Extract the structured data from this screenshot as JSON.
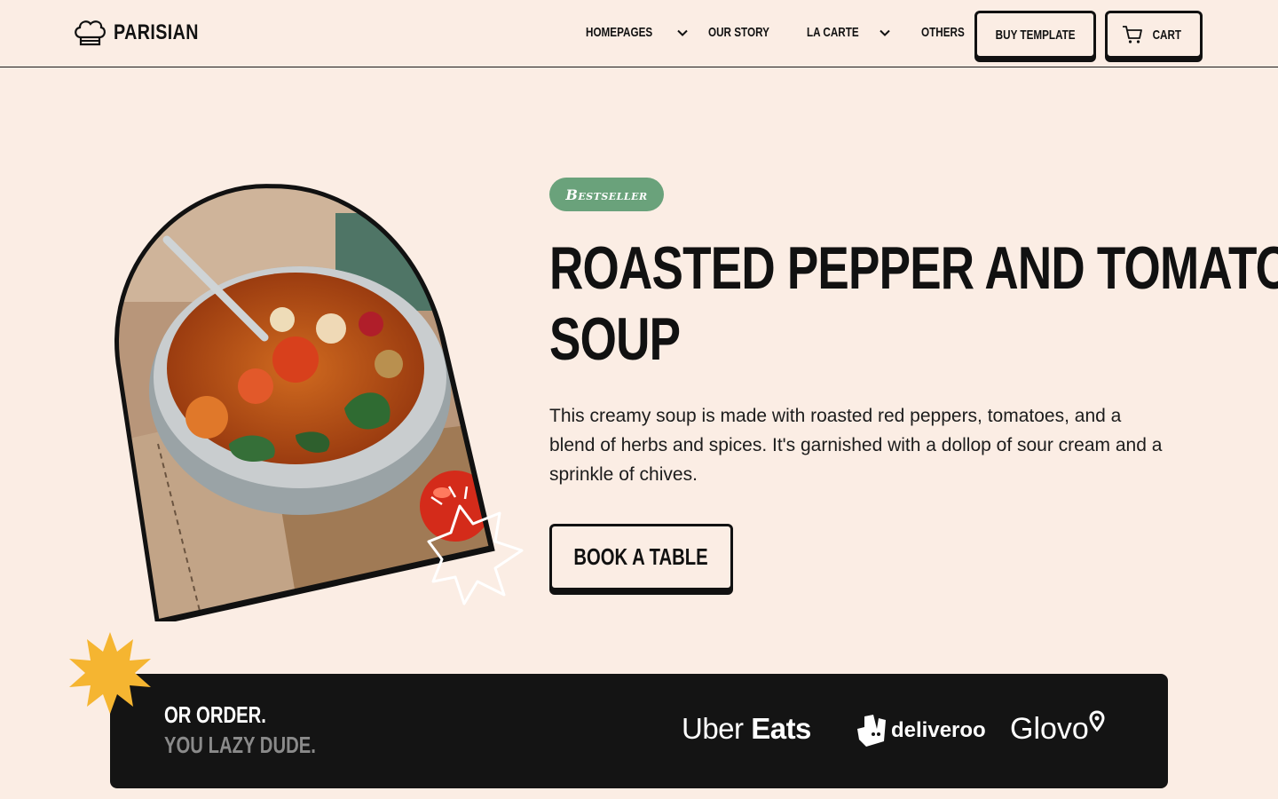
{
  "brand": {
    "name": "PARISIAN",
    "logo_icon": "chef-hat-icon"
  },
  "nav": {
    "items": [
      {
        "label": "HOMEPAGES",
        "has_dropdown": true
      },
      {
        "label": "OUR STORY",
        "has_dropdown": false
      },
      {
        "label": "LA CARTE",
        "has_dropdown": true
      },
      {
        "label": "OTHERS",
        "has_dropdown": true
      }
    ],
    "buy_label": "BUY TEMPLATE",
    "cart_label": "CART",
    "cart_icon": "cart-icon"
  },
  "hero": {
    "badge": "Bestseller",
    "title_line1": "ROASTED PEPPER AND TOMATO",
    "title_line2": "SOUP",
    "description": "This creamy soup is made with roasted red peppers, tomatoes, and a blend of herbs and spices. It's garnished with a dollop of sour cream and a sprinkle of chives.",
    "cta": "BOOK A TABLE",
    "image_icon": "soup-bowl-image"
  },
  "order": {
    "line1": "OR ORDER.",
    "line2": "YOU LAZY DUDE.",
    "partners": [
      "Uber Eats",
      "deliveroo",
      "Glovo"
    ],
    "uber_part1": "Uber",
    "uber_part2": "Eats",
    "glovo_part": "Glovo"
  },
  "colors": {
    "background": "#fbede4",
    "text": "#111111",
    "badge": "#6aa27b",
    "banner": "#141414",
    "star": "#f5b531",
    "subtext": "#8a8a8a"
  }
}
